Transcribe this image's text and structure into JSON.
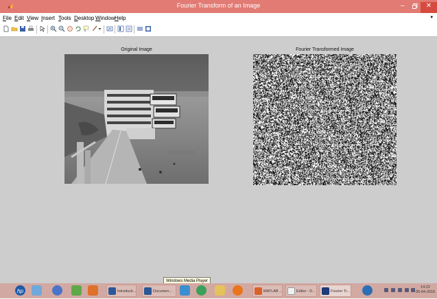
{
  "window": {
    "title": "Fourier Transform of an Image",
    "controls": {
      "minimize": "–",
      "maximize": "🗗",
      "close": "✕"
    }
  },
  "menu": {
    "items": [
      {
        "label": "File",
        "key": "F"
      },
      {
        "label": "Edit",
        "key": "E"
      },
      {
        "label": "View",
        "key": "V"
      },
      {
        "label": "Insert",
        "key": "I"
      },
      {
        "label": "Tools",
        "key": "T"
      },
      {
        "label": "Desktop",
        "key": "D"
      },
      {
        "label": "Window",
        "key": "W"
      },
      {
        "label": "Help",
        "key": "H"
      }
    ],
    "overflow": "▾"
  },
  "toolbar": {
    "buttons": [
      "new-figure-icon",
      "open-file-icon",
      "save-icon",
      "print-icon",
      "edit-plot-icon",
      "zoom-in-icon",
      "zoom-out-icon",
      "pan-icon",
      "rotate-3d-icon",
      "data-cursor-icon",
      "brush-icon",
      "link-plot-icon",
      "colorbar-icon",
      "legend-icon",
      "hide-plot-tools-icon",
      "show-plot-tools-icon"
    ]
  },
  "figure": {
    "left_axes_title": "Original Image",
    "right_axes_title": "Fourier Transformed Image"
  },
  "tooltip": "Windows Media Player",
  "taskbar": {
    "buttons": [
      {
        "label": "Introducti...",
        "icon": "word-icon"
      },
      {
        "label": "Documen...",
        "icon": "word-icon"
      },
      {
        "label": "MATLAB ...",
        "icon": "matlab-icon"
      },
      {
        "label": "Editor - D...",
        "icon": "editor-icon"
      },
      {
        "label": "Fourier Tr...",
        "icon": "figure-icon"
      }
    ],
    "clock_time": "14:22",
    "clock_date": "05-04-2016"
  },
  "colors": {
    "titlebar": "#e17b74",
    "close_button": "#d64b3f",
    "figure_background": "#cdcdcd",
    "taskbar": "#d2a9a2"
  }
}
